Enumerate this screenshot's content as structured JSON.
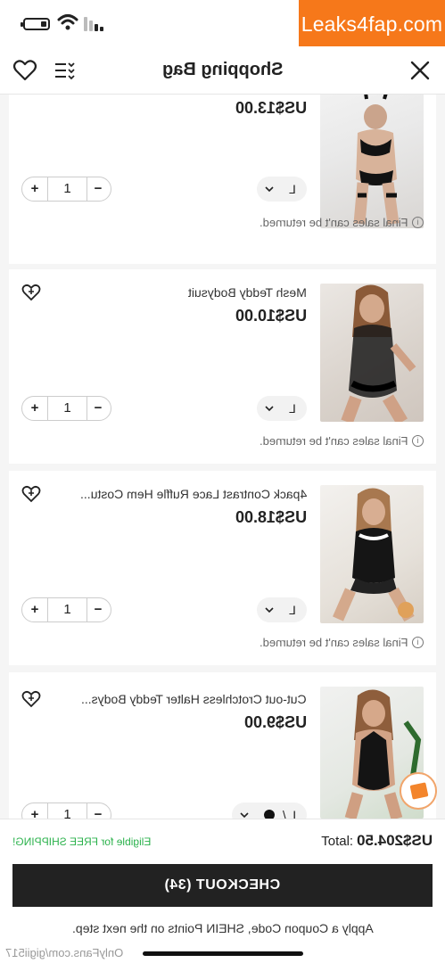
{
  "watermark": "Leaks4fap.com",
  "header": {
    "title": "Shopping Bag",
    "icons": [
      "heart-icon",
      "filter-list-icon",
      "close-icon"
    ]
  },
  "items": [
    {
      "name": "",
      "price": "US$13.00",
      "size": "L",
      "qty": "1",
      "plus": "+",
      "minus": "−",
      "note": "Final sales can't be returned.",
      "swatch": "#1a1a1a"
    },
    {
      "name": "Mesh Teddy Bodysuit",
      "price": "US$10.00",
      "size": "L",
      "qty": "1",
      "plus": "+",
      "minus": "−",
      "note": "Final sales can't be returned.",
      "swatch": "#141414"
    },
    {
      "name": "4pack Contrast Lace Ruffle Hem Costu...",
      "price": "US$18.00",
      "size": "L",
      "qty": "1",
      "plus": "+",
      "minus": "−",
      "note": "Final sales can't be returned.",
      "swatch": "#1c1c1c"
    },
    {
      "name": "Cut-out Crotchless Halter Teddy Bodys...",
      "price": "US$9.00",
      "size": "L /",
      "qty": "1",
      "plus": "+",
      "minus": "−",
      "note": "",
      "swatch": "#111111"
    }
  ],
  "bottom": {
    "total_label": "Total:",
    "total_value": "US$204.50",
    "shipping": "Eligible for FREE SHIPPING!",
    "checkout": "CHECKOUT (34)",
    "apply": "Apply a Coupon Code, SHEIN Points on the next step.",
    "footer_watermark": "OnlyFans.com/gigii517"
  },
  "colors": {
    "accent_dark": "#222222",
    "shipping_green": "#2bb24c",
    "watermark_orange": "#f6781a"
  }
}
